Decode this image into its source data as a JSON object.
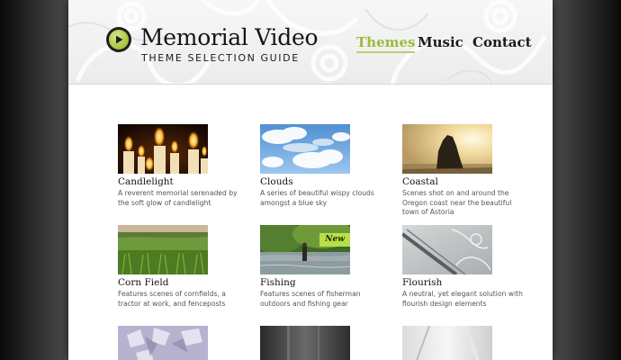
{
  "header": {
    "title": "Memorial Video",
    "subtitle": "THEME SELECTION GUIDE"
  },
  "nav": {
    "items": [
      {
        "label": "Themes",
        "active": true
      },
      {
        "label": "Music",
        "active": false
      },
      {
        "label": "Contact",
        "active": false
      }
    ]
  },
  "colors": {
    "accent": "#9bbb3c",
    "badge": "#b8e04a"
  },
  "themes": [
    {
      "title": "Candlelight",
      "description": "A reverent memorial serenaded by the soft glow of candlelight",
      "badge": ""
    },
    {
      "title": "Clouds",
      "description": "A series of beautiful wispy clouds amongst a blue sky",
      "badge": ""
    },
    {
      "title": "Coastal",
      "description": "Scenes shot on and around the Oregon coast near the beautiful town of Astoria",
      "badge": ""
    },
    {
      "title": "Corn Field",
      "description": "Features scenes of cornfields, a tractor at work, and fenceposts",
      "badge": ""
    },
    {
      "title": "Fishing",
      "description": "Features scenes of fisherman outdoors and fishing gear",
      "badge": "New"
    },
    {
      "title": "Flourish",
      "description": "A neutral, yet elegant solution with flourish design elements",
      "badge": ""
    },
    {
      "title": "",
      "description": "",
      "badge": ""
    },
    {
      "title": "",
      "description": "",
      "badge": ""
    },
    {
      "title": "",
      "description": "",
      "badge": ""
    }
  ]
}
